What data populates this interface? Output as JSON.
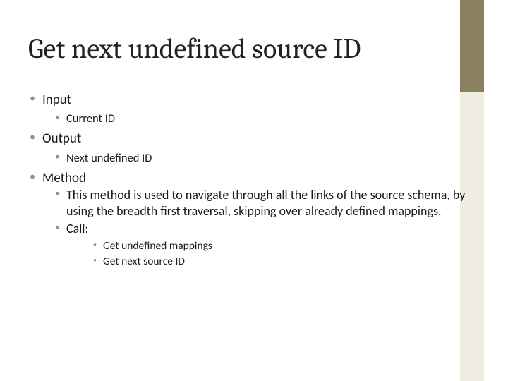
{
  "title": "Get next undefined source ID",
  "bullets": {
    "input": {
      "label": "Input",
      "items": [
        "Current ID"
      ]
    },
    "output": {
      "label": "Output",
      "items": [
        "Next undefined ID"
      ]
    },
    "method": {
      "label": "Method",
      "desc": "This method is used to navigate through all the links of the source schema, by using the breadth first traversal, skipping over already defined mappings.",
      "call_label": "Call:",
      "calls": [
        "Get undefined mappings",
        "Get next source ID"
      ]
    }
  }
}
